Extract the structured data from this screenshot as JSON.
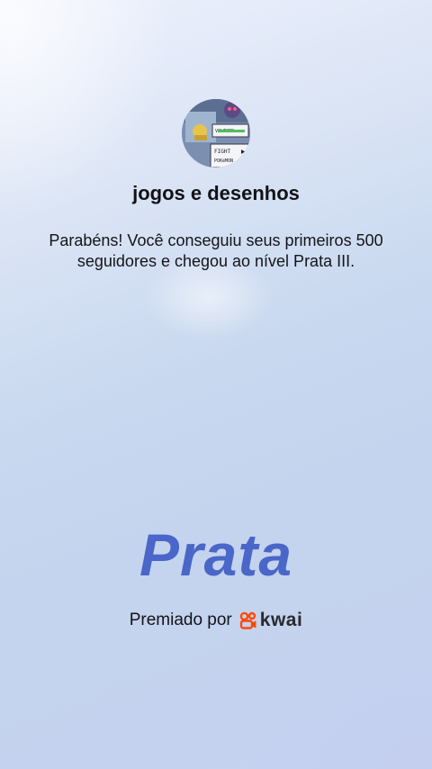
{
  "profile": {
    "username": "jogos e desenhos",
    "avatar_game_menu": [
      "FIGHT",
      "POKéMON"
    ],
    "avatar_game_label": "VOLTORB"
  },
  "message": "Parabéns! Você conseguiu seus primeiros 500 seguidores e chegou ao nível Prata III.",
  "level_title": "Prata",
  "award": {
    "label": "Premiado por",
    "brand_name": "kwai",
    "brand_icon": "kwai-logo-icon",
    "brand_color": "#ff4906"
  },
  "colors": {
    "level_title": "#4a66c8",
    "background_start": "#eef1fd",
    "background_end": "#c6d2f0"
  }
}
